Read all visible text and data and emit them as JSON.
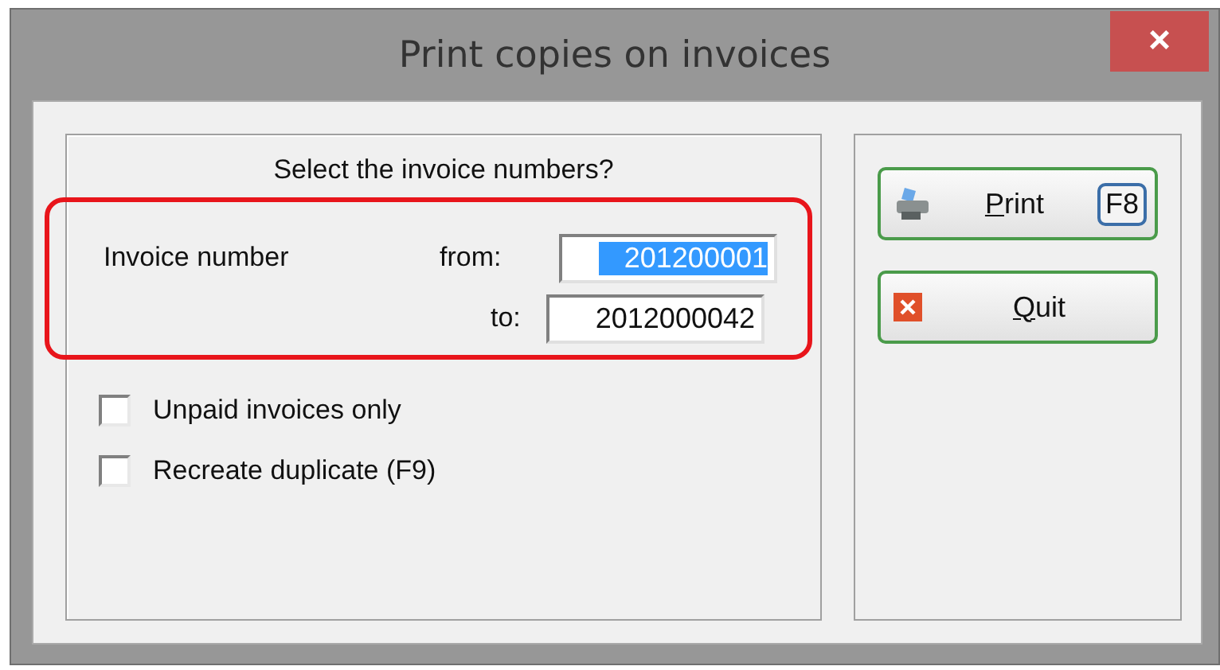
{
  "window": {
    "title": "Print copies on invoices",
    "close": "×"
  },
  "prompt": "Select the invoice numbers?",
  "range": {
    "label": "Invoice number",
    "from": {
      "label": "from:",
      "value": "201200001",
      "selected": true
    },
    "to": {
      "label": "to:",
      "value": "2012000042",
      "selected": false
    }
  },
  "options": [
    {
      "label": "Unpaid invoices only",
      "checked": false
    },
    {
      "label": "Recreate duplicate (F9)",
      "checked": false
    }
  ],
  "buttons": [
    {
      "kind": "print",
      "label": "Print",
      "shortcut": "F8"
    },
    {
      "kind": "quit",
      "label": "Quit"
    }
  ]
}
